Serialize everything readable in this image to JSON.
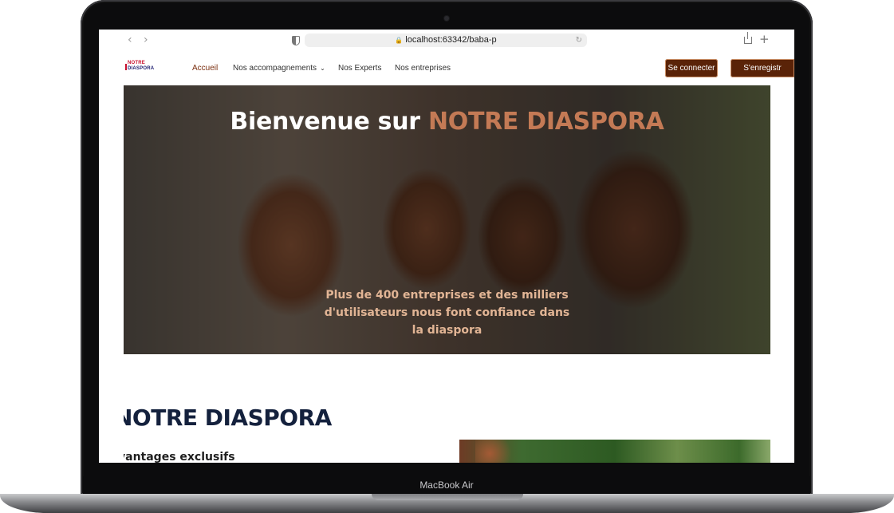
{
  "device": {
    "label": "MacBook Air"
  },
  "browser": {
    "back_icon": "chevron-left",
    "forward_icon": "chevron-right",
    "url": "localhost:63342/baba-p",
    "share_icon": "share",
    "new_tab_icon": "plus"
  },
  "site": {
    "logo": {
      "line1": "NOTRE",
      "line2": "DIASPORA"
    },
    "nav": [
      {
        "label": "Accueil",
        "active": true
      },
      {
        "label": "Nos accompagnements",
        "dropdown": true
      },
      {
        "label": "Nos Experts"
      },
      {
        "label": "Nos entreprises"
      }
    ],
    "login_button": "Se connecter",
    "register_button": "S'enregistr",
    "colors": {
      "brand_brown": "#5a2308",
      "accent": "#c47a55",
      "nav_active": "#7a2e0e",
      "heading": "#14213d"
    }
  },
  "hero": {
    "title_prefix": "Bienvenue sur ",
    "title_accent": "NOTRE DIASPORA",
    "subtitle": "Plus de 400 entreprises et des milliers d'utilisateurs nous font confiance dans la diaspora"
  },
  "section": {
    "title": "NOTRE DIASPORA",
    "subtitle": "vantages exclusifs"
  }
}
